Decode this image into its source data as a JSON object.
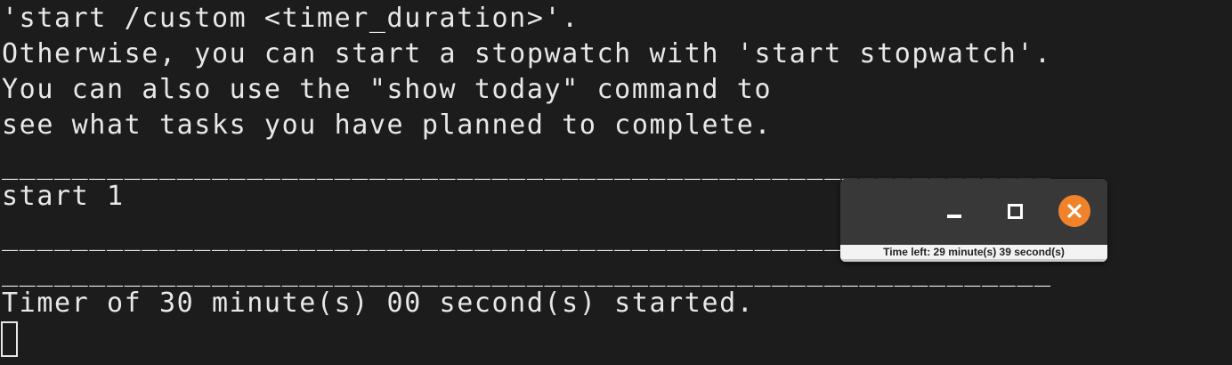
{
  "terminal": {
    "lines": [
      "'start /custom <timer_duration>'.",
      "Otherwise, you can start a stopwatch with 'start stopwatch'.",
      "You can also use the \"show today\" command to",
      "see what tasks you have planned to complete.",
      "",
      "____________________________________________________________",
      "start 1",
      "",
      "____________________________________________________________",
      "____________________________________________________________",
      "Timer of 30 minute(s) 00 second(s) started."
    ]
  },
  "timer_window": {
    "status": "Time left: 29 minute(s) 39 second(s)",
    "colors": {
      "close_button": "#f0832a",
      "titlebar": "#383838",
      "strip": "#f3f3f3"
    },
    "icons": {
      "minimize": "minimize-icon",
      "maximize": "maximize-icon",
      "close": "close-icon"
    }
  }
}
